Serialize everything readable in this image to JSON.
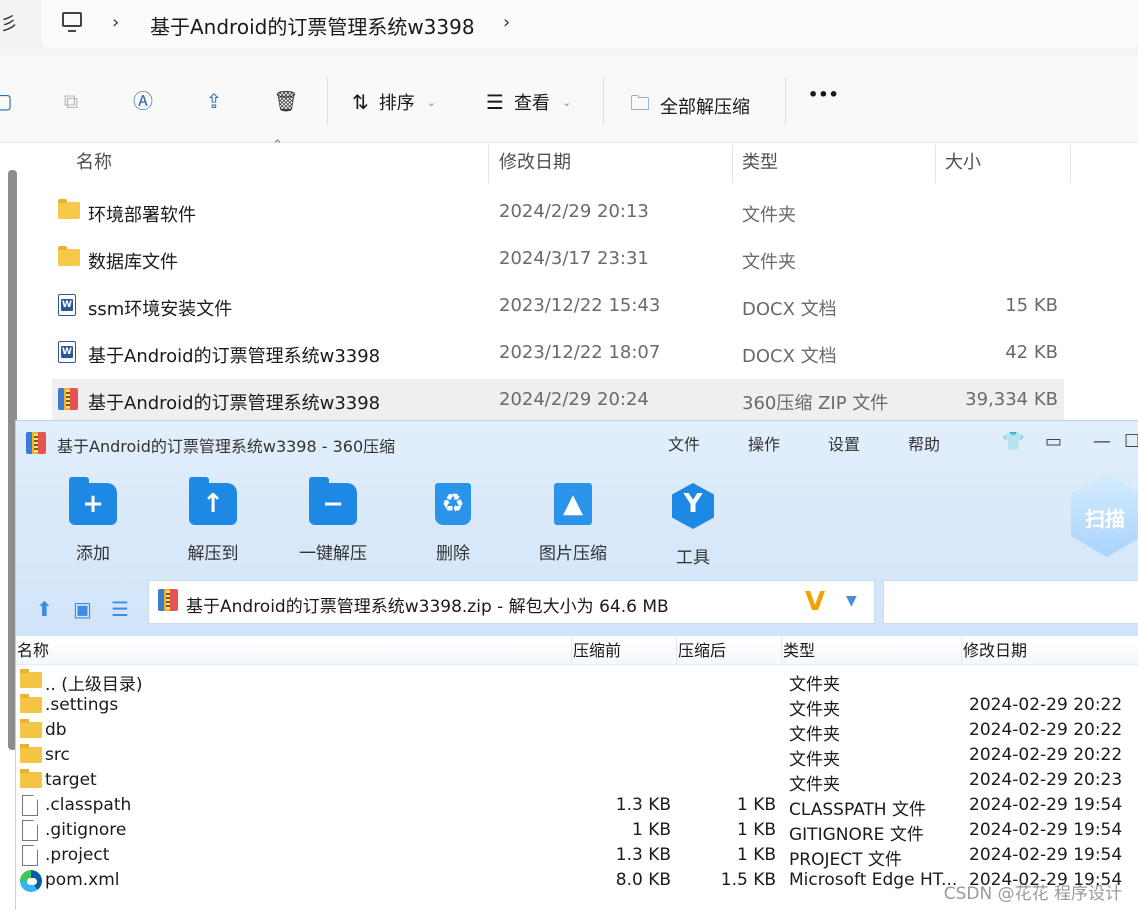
{
  "explorer": {
    "address": {
      "left_glyph": "彡",
      "title": "基于Android的订票管理系统w3398"
    },
    "toolbar": {
      "sort_label": "排序",
      "view_label": "查看",
      "extract_all_label": "全部解压缩",
      "more_label": "•••"
    },
    "columns": {
      "name": "名称",
      "date": "修改日期",
      "type": "类型",
      "size": "大小"
    },
    "rows": [
      {
        "icon": "folder-icon",
        "name": "环境部署软件",
        "date": "2024/2/29 20:13",
        "type": "文件夹",
        "size": ""
      },
      {
        "icon": "folder-icon",
        "name": "数据库文件",
        "date": "2024/3/17 23:31",
        "type": "文件夹",
        "size": ""
      },
      {
        "icon": "word-doc-icon",
        "name": "ssm环境安装文件",
        "date": "2023/12/22 15:43",
        "type": "DOCX 文档",
        "size": "15 KB"
      },
      {
        "icon": "word-doc-icon",
        "name": "基于Android的订票管理系统w3398",
        "date": "2023/12/22 18:07",
        "type": "DOCX 文档",
        "size": "42 KB"
      },
      {
        "icon": "zip-archive-icon",
        "name": "基于Android的订票管理系统w3398",
        "date": "2024/2/29 20:24",
        "type": "360压缩 ZIP 文件",
        "size": "39,334 KB",
        "selected": true
      }
    ]
  },
  "zip": {
    "title": "基于Android的订票管理系统w3398 - 360压缩",
    "menu": [
      "文件",
      "操作",
      "设置",
      "帮助"
    ],
    "tools": [
      {
        "icon": "add-icon",
        "label": "添加"
      },
      {
        "icon": "extract-to-icon",
        "label": "解压到"
      },
      {
        "icon": "one-click-extract-icon",
        "label": "一键解压"
      },
      {
        "icon": "delete-icon",
        "label": "删除"
      },
      {
        "icon": "image-compress-icon",
        "label": "图片压缩"
      },
      {
        "icon": "tools-icon",
        "label": "工具"
      }
    ],
    "scan_label": "扫描",
    "path_text": "基于Android的订票管理系统w3398.zip - 解包大小为 64.6 MB",
    "columns": {
      "name": "名称",
      "before": "压缩前",
      "after": "压缩后",
      "type": "类型",
      "date": "修改日期"
    },
    "rows": [
      {
        "icon": "folder-icon",
        "name": ".. (上级目录)",
        "before": "",
        "after": "",
        "type": "文件夹",
        "date": ""
      },
      {
        "icon": "folder-icon",
        "name": ".settings",
        "before": "",
        "after": "",
        "type": "文件夹",
        "date": "2024-02-29 20:22"
      },
      {
        "icon": "folder-icon",
        "name": "db",
        "before": "",
        "after": "",
        "type": "文件夹",
        "date": "2024-02-29 20:22"
      },
      {
        "icon": "folder-icon",
        "name": "src",
        "before": "",
        "after": "",
        "type": "文件夹",
        "date": "2024-02-29 20:22"
      },
      {
        "icon": "folder-icon",
        "name": "target",
        "before": "",
        "after": "",
        "type": "文件夹",
        "date": "2024-02-29 20:23"
      },
      {
        "icon": "file-icon",
        "name": ".classpath",
        "before": "1.3 KB",
        "after": "1 KB",
        "type": "CLASSPATH 文件",
        "date": "2024-02-29 19:54"
      },
      {
        "icon": "file-icon",
        "name": ".gitignore",
        "before": "1 KB",
        "after": "1 KB",
        "type": "GITIGNORE 文件",
        "date": "2024-02-29 19:54"
      },
      {
        "icon": "file-icon",
        "name": ".project",
        "before": "1.3 KB",
        "after": "1 KB",
        "type": "PROJECT 文件",
        "date": "2024-02-29 19:54"
      },
      {
        "icon": "edge-icon",
        "name": "pom.xml",
        "before": "8.0 KB",
        "after": "1.5 KB",
        "type": "Microsoft Edge HT...",
        "date": "2024-02-29 19:54"
      }
    ]
  },
  "watermark": "CSDN @花花 程序设计"
}
